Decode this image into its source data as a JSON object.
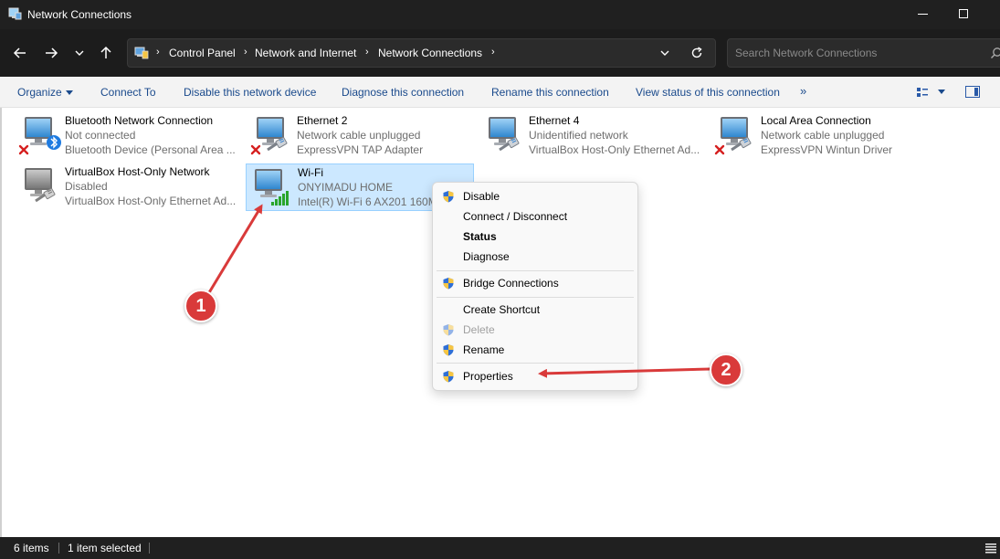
{
  "window": {
    "title": "Network Connections"
  },
  "address": {
    "crumbs": [
      "Control Panel",
      "Network and Internet",
      "Network Connections"
    ]
  },
  "search": {
    "placeholder": "Search Network Connections"
  },
  "toolbar": {
    "organize": "Organize",
    "connect_to": "Connect To",
    "disable": "Disable this network device",
    "diagnose": "Diagnose this connection",
    "rename": "Rename this connection",
    "view_status": "View status of this connection",
    "more": "»"
  },
  "connections": [
    {
      "name": "Bluetooth Network Connection",
      "status": "Not connected",
      "device": "Bluetooth Device (Personal Area ...",
      "icon": "bluetooth-network-icon"
    },
    {
      "name": "Ethernet 2",
      "status": "Network cable unplugged",
      "device": "ExpressVPN TAP Adapter",
      "icon": "ethernet-disconnected-icon"
    },
    {
      "name": "Ethernet 4",
      "status": "Unidentified network",
      "device": "VirtualBox Host-Only Ethernet Ad...",
      "icon": "ethernet-icon"
    },
    {
      "name": "Local Area Connection",
      "status": "Network cable unplugged",
      "device": "ExpressVPN Wintun Driver",
      "icon": "ethernet-disconnected-icon"
    },
    {
      "name": "VirtualBox Host-Only Network",
      "status": "Disabled",
      "device": "VirtualBox Host-Only Ethernet Ad...",
      "icon": "ethernet-disabled-icon"
    },
    {
      "name": "Wi-Fi",
      "status": "ONYIMADU HOME",
      "device": "Intel(R) Wi-Fi 6 AX201 160M",
      "icon": "wifi-icon"
    }
  ],
  "context_menu": {
    "items": [
      {
        "label": "Disable",
        "shield": true
      },
      {
        "label": "Connect / Disconnect",
        "shield": false
      },
      {
        "label": "Status",
        "shield": false,
        "bold": true
      },
      {
        "label": "Diagnose",
        "shield": false
      },
      {
        "label": "Bridge Connections",
        "shield": true
      },
      {
        "label": "Create Shortcut",
        "shield": false
      },
      {
        "label": "Delete",
        "shield": true,
        "disabled": true
      },
      {
        "label": "Rename",
        "shield": true
      },
      {
        "label": "Properties",
        "shield": true
      }
    ]
  },
  "annotations": {
    "badge1": "1",
    "badge2": "2",
    "color": "#d93a3a"
  },
  "statusbar": {
    "items_count": "6 items",
    "selected_count": "1 item selected"
  },
  "colors": {
    "accent": "#1a4a8c",
    "selection": "#cce8ff",
    "titlebar": "#202020"
  }
}
